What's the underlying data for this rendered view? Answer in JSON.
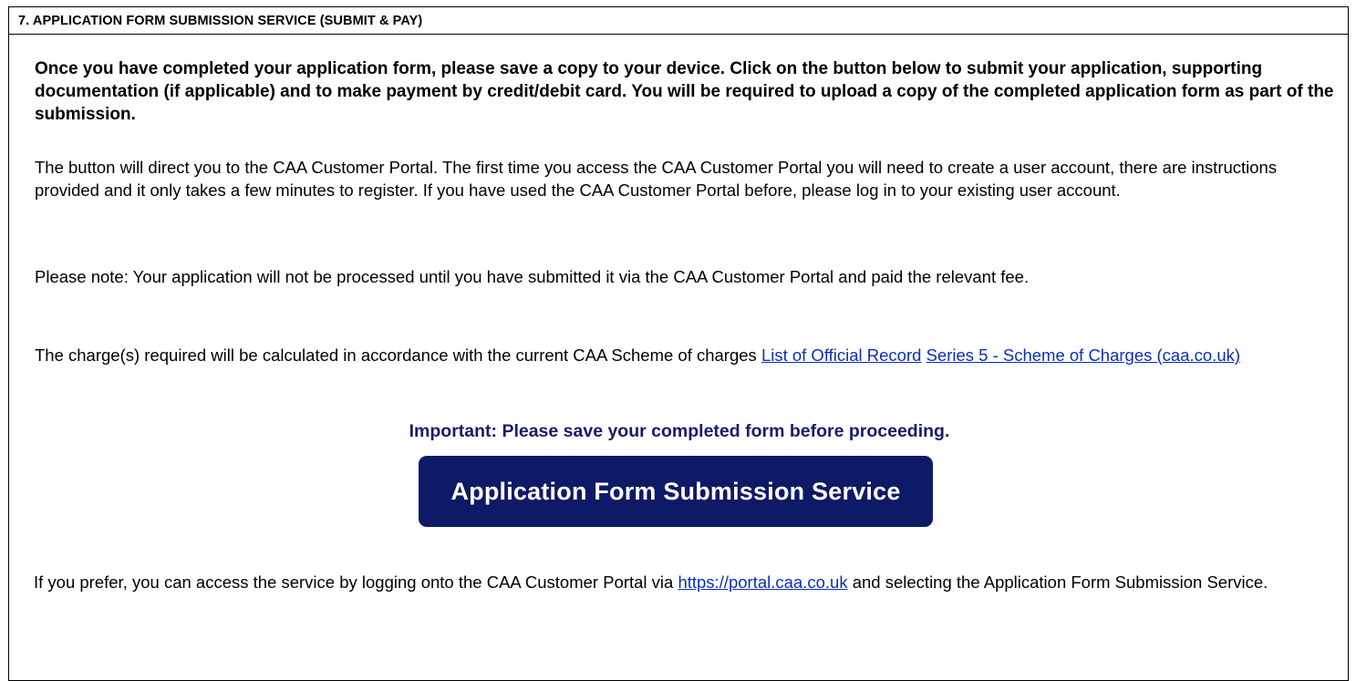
{
  "section": {
    "title": "7.   APPLICATION FORM SUBMISSION SERVICE (SUBMIT & PAY)"
  },
  "intro_bold": "Once you have completed your application form, please save a copy to your device. Click on the button below to submit your application, supporting documentation (if applicable) and to make payment by credit/debit card. You will be required to upload a copy of the completed application form as part of the submission.",
  "portal_info": "The button will direct you to the CAA Customer Portal. The first time you access the CAA Customer Portal you will need to create a user account, there are instructions provided and it only takes a few minutes to register.  If you have used the CAA Customer Portal before, please log in to your existing user account.",
  "note": "Please note: Your application will not be processed until you have submitted it via the CAA Customer Portal and paid the relevant fee.",
  "charges": {
    "text": "The charge(s) required will be calculated in accordance with the current CAA Scheme of charges ",
    "link1": "List of Official Record",
    "link2": "Series 5 - Scheme of Charges (caa.co.uk)"
  },
  "important": "Important: Please save your completed form before proceeding.",
  "button_label": "Application Form Submission Service",
  "alt_access": {
    "before": "If you prefer, you can access the service by logging onto the CAA Customer Portal via ",
    "link": "https://portal.caa.co.uk",
    "after": " and selecting the Application Form Submission Service."
  },
  "colors": {
    "button_bg": "#0e1a66",
    "important_text": "#1a1a6e",
    "link": "#0b2fb8"
  }
}
